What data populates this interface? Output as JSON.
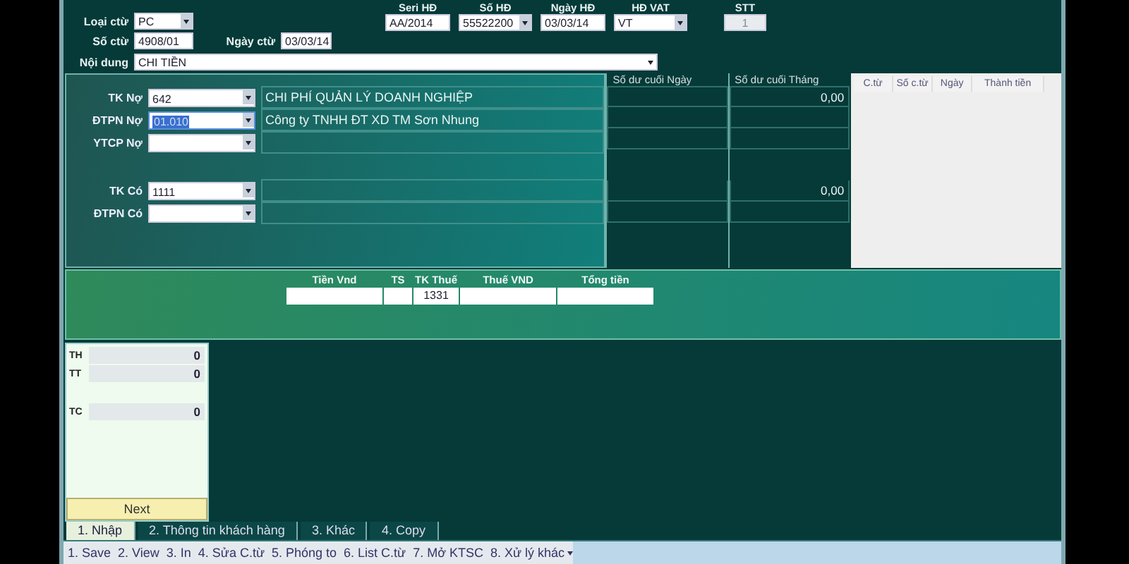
{
  "header": {
    "voucher_type": {
      "label": "Loại ctừ",
      "value": "PC"
    },
    "voucher_no": {
      "label": "Số ctừ",
      "value": "4908/01"
    },
    "voucher_date": {
      "label": "Ngày ctừ",
      "value": "03/03/14"
    },
    "description": {
      "label": "Nội dung",
      "value": "CHI TIỀN"
    },
    "invoice": [
      {
        "label": "Seri HĐ",
        "value": "AA/2014",
        "kind": "text"
      },
      {
        "label": "Số HĐ",
        "value": "55522200",
        "kind": "combo"
      },
      {
        "label": "Ngày HĐ",
        "value": "03/03/14",
        "kind": "text"
      },
      {
        "label": "HĐ VAT",
        "value": "VT",
        "kind": "combo"
      },
      {
        "label": "STT",
        "value": "1",
        "kind": "readonly"
      }
    ]
  },
  "balance_titles": {
    "day": "Số dư cuối Ngày",
    "month": "Số dư cuối Tháng"
  },
  "debit": [
    {
      "label": "TK Nợ",
      "value": "642",
      "name": "CHI PHÍ QUẢN LÝ DOANH NGHIỆP",
      "month": "0,00",
      "selected": false
    },
    {
      "label": "ĐTPN Nợ",
      "value": "01.010",
      "name": "Công ty TNHH ĐT XD TM Sơn Nhung",
      "selected": true
    },
    {
      "label": "YTCP Nợ",
      "selected": false
    }
  ],
  "credit": [
    {
      "label": "TK Có",
      "value": "1111",
      "month": "0,00",
      "selected": false
    },
    {
      "label": "ĐTPN Có",
      "selected": false
    }
  ],
  "grid": {
    "columns": [
      "C.từ",
      "Số c.từ",
      "Ngày",
      "Thành tiền"
    ]
  },
  "vat": [
    {
      "label": "Tiền Vnd",
      "kind": "wide"
    },
    {
      "label": "TS",
      "kind": "narrow"
    },
    {
      "label": "TK Thuế",
      "value": "1331",
      "kind": "medium"
    },
    {
      "label": "Thuế VND",
      "kind": "wide"
    },
    {
      "label": "Tổng tiền",
      "kind": "wide"
    }
  ],
  "total_groups": [
    {
      "items": [
        {
          "label": "TH",
          "value": "0"
        },
        {
          "label": "TT",
          "value": "0"
        }
      ]
    },
    {
      "items": [
        {
          "label": "TC",
          "value": "0"
        }
      ]
    }
  ],
  "next_button": "Next",
  "tabs": [
    {
      "label": "1. Nhập",
      "selected": true
    },
    {
      "label": "2. Thông tin khách hàng",
      "selected": false
    },
    {
      "label": "3. Khác",
      "selected": false
    },
    {
      "label": "4. Copy",
      "selected": false
    }
  ],
  "toolbar": [
    {
      "label": "1. Save",
      "dropdown": false
    },
    {
      "label": "2. View",
      "dropdown": false
    },
    {
      "label": "3. In",
      "dropdown": false
    },
    {
      "label": "4. Sửa C.từ",
      "dropdown": false
    },
    {
      "label": "5. Phóng to",
      "dropdown": false
    },
    {
      "label": "6. List C.từ",
      "dropdown": false
    },
    {
      "label": "7. Mở KTSC",
      "dropdown": false
    },
    {
      "label": "8. Xử lý khác",
      "dropdown": true
    }
  ]
}
